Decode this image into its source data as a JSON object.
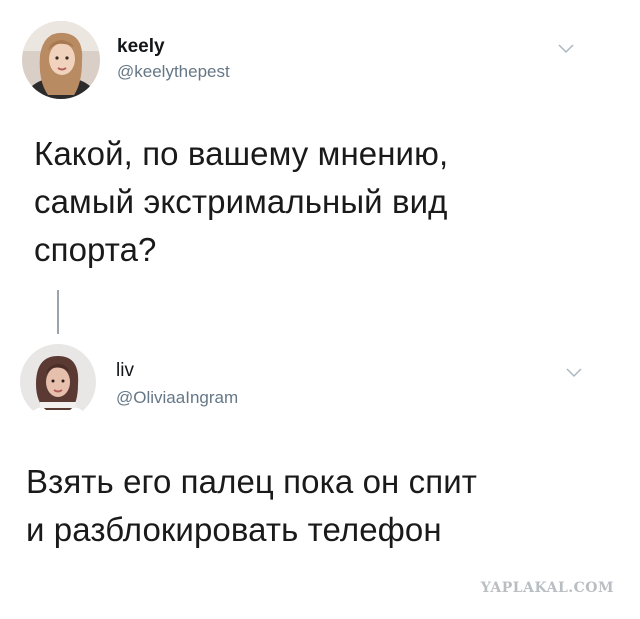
{
  "tweet1": {
    "name": "keely",
    "handle": "@keelythepest",
    "text_lines": [
      "Какой, по вашему мнению,",
      "самый экстримальный вид",
      "спорта?"
    ],
    "avatar_icon": "user-avatar-icon",
    "menu_icon": "chevron-down-icon"
  },
  "tweet2": {
    "name": "liv",
    "handle": "@OliviaaIngram",
    "text_lines": [
      "Взять его палец пока он спит",
      "и разблокировать телефон"
    ],
    "avatar_icon": "user-avatar-icon",
    "menu_icon": "chevron-down-icon"
  },
  "watermark": "YAPLAKAL.COM",
  "colors": {
    "handle": "#657786",
    "thread_line": "#9aa4ad",
    "chevron": "#aab8c2",
    "watermark": "#b9bec3"
  }
}
